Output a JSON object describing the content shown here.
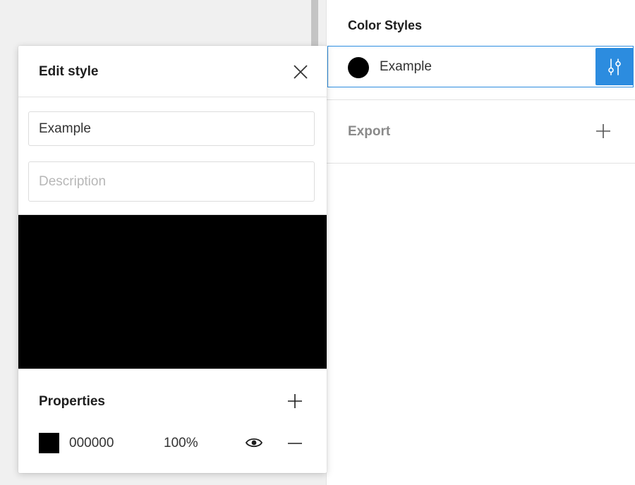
{
  "right_panel": {
    "section_title": "Color Styles",
    "styles": [
      {
        "name": "Example",
        "color": "#000000"
      }
    ],
    "export_label": "Export"
  },
  "edit_style": {
    "title": "Edit style",
    "name_value": "Example",
    "description_placeholder": "Description",
    "preview_color": "#000000",
    "properties_title": "Properties",
    "fill": {
      "hex": "000000",
      "opacity": "100%"
    }
  },
  "colors": {
    "accent": "#2c8cdf",
    "canvas": "#f0f0f0"
  },
  "icons": {
    "close": "close-icon",
    "adjust": "sliders-icon",
    "add": "plus-icon",
    "visibility": "eye-icon",
    "remove": "minus-icon"
  }
}
